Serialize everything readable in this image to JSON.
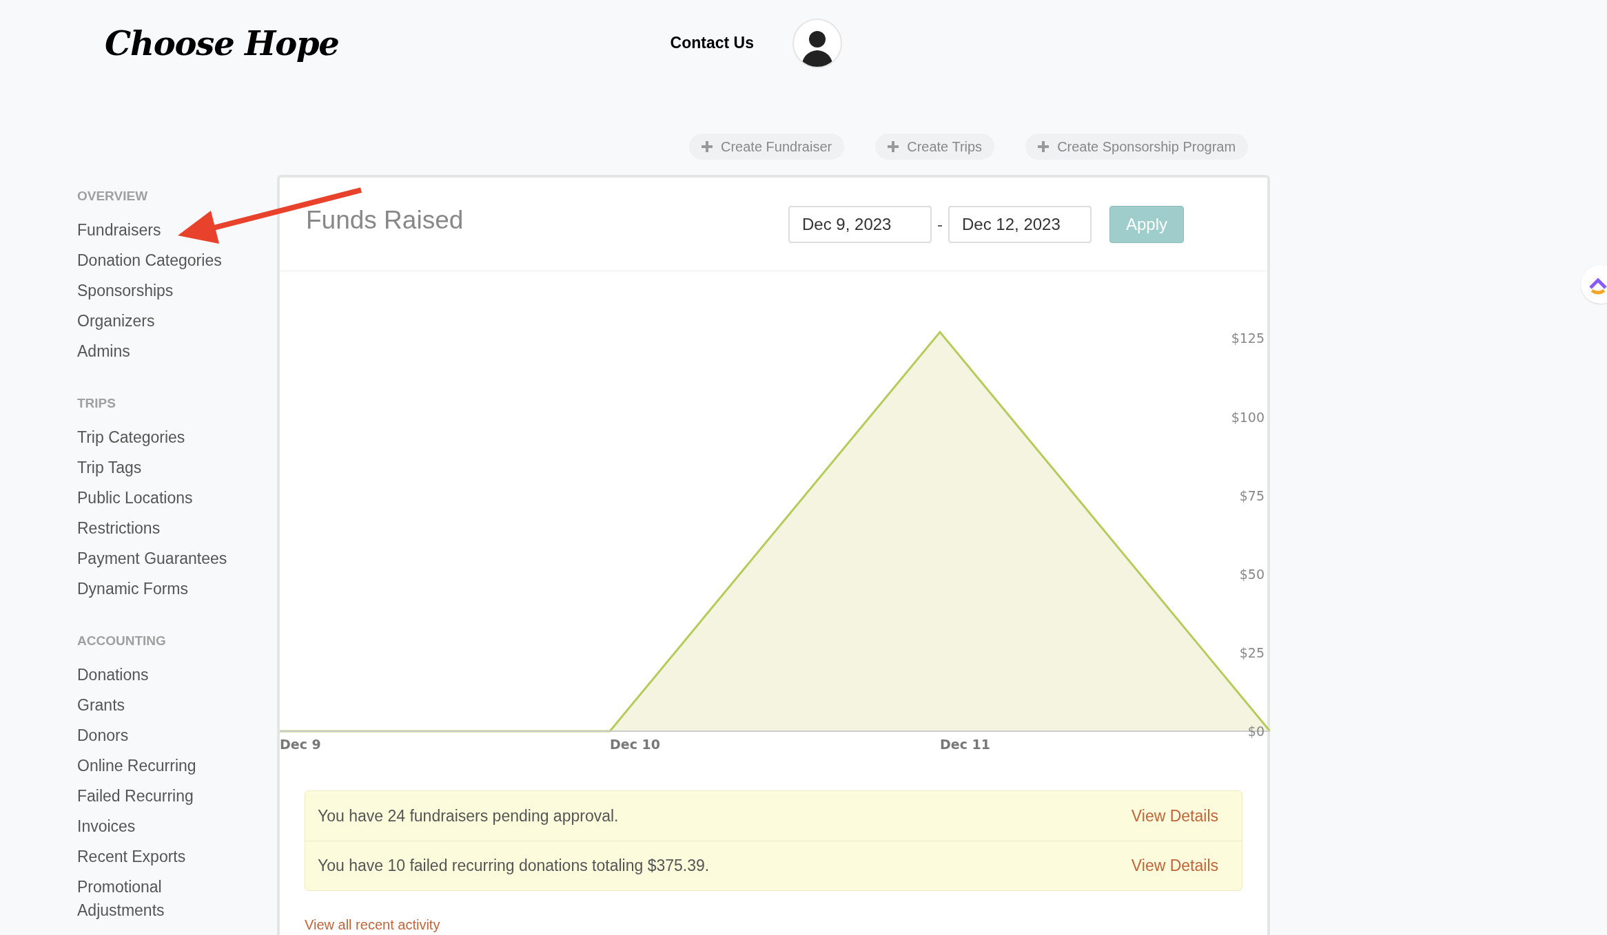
{
  "header": {
    "logo": "Choose Hope",
    "contact": "Contact Us"
  },
  "actions": [
    {
      "label": "Create Fundraiser"
    },
    {
      "label": "Create Trips"
    },
    {
      "label": "Create Sponsorship Program"
    }
  ],
  "sidebar": [
    {
      "heading": "OVERVIEW",
      "items": [
        "Fundraisers",
        "Donation Categories",
        "Sponsorships",
        "Organizers",
        "Admins"
      ]
    },
    {
      "heading": "TRIPS",
      "items": [
        "Trip Categories",
        "Trip Tags",
        "Public Locations",
        "Restrictions",
        "Payment Guarantees",
        "Dynamic Forms"
      ]
    },
    {
      "heading": "ACCOUNTING",
      "items": [
        "Donations",
        "Grants",
        "Donors",
        "Online Recurring",
        "Failed Recurring",
        "Invoices",
        "Recent Exports",
        "Promotional Adjustments"
      ]
    }
  ],
  "panel": {
    "title": "Funds Raised",
    "start_date": "Dec 9, 2023",
    "separator": "-",
    "end_date": "Dec 12, 2023",
    "apply": "Apply",
    "chart_data": {
      "type": "area",
      "categories": [
        "Dec 9",
        "Dec 10",
        "Dec 11",
        null
      ],
      "ylim": [
        0,
        177
      ],
      "yticks": [
        {
          "value": 0,
          "label": "$0"
        },
        {
          "value": 25,
          "label": "$25"
        },
        {
          "value": 50,
          "label": "$50"
        },
        {
          "value": 75,
          "label": "$75"
        },
        {
          "value": 100,
          "label": "$100"
        },
        {
          "value": 125,
          "label": "$125"
        }
      ],
      "series": [
        {
          "color": "#b5cc5a",
          "values": [
            0,
            0,
            127,
            0
          ]
        }
      ]
    },
    "alerts": [
      {
        "text": "You have 24 fundraisers pending approval.",
        "link": "View Details"
      },
      {
        "text": "You have 10 failed recurring donations totaling $375.39.",
        "link": "View Details"
      }
    ],
    "recent_link": "View all recent activity"
  }
}
